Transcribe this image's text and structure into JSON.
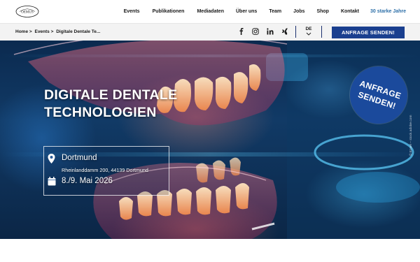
{
  "header": {
    "nav": [
      {
        "label": "Events",
        "name": "nav-events"
      },
      {
        "label": "Publikationen",
        "name": "nav-publikationen"
      },
      {
        "label": "Mediadaten",
        "name": "nav-mediadaten"
      },
      {
        "label": "Über uns",
        "name": "nav-ueber-uns"
      },
      {
        "label": "Team",
        "name": "nav-team"
      },
      {
        "label": "Jobs",
        "name": "nav-jobs"
      },
      {
        "label": "Shop",
        "name": "nav-shop"
      },
      {
        "label": "Kontakt",
        "name": "nav-kontakt"
      }
    ],
    "jubilee": "30 starke Jahre"
  },
  "breadcrumb": {
    "items": [
      "Home >",
      "Events >",
      "Digitale Dentale Te..."
    ]
  },
  "social": {
    "icons": [
      "facebook-icon",
      "instagram-icon",
      "linkedin-icon",
      "xing-icon"
    ]
  },
  "language": {
    "current": "DE"
  },
  "cta": {
    "label": "ANFRAGE SENDEN!"
  },
  "hero": {
    "title_line1": "DIGITALE DENTALE",
    "title_line2": "TECHNOLOGIEN",
    "city": "Dortmund",
    "address": "Rheinlanddamm 200, 44139 Dortmund",
    "date": "8./9. Mai 2026",
    "badge_line1": "ANFRAGE",
    "badge_line2": "SENDEN!",
    "credit": "© Ezael – stock.adobe.com"
  },
  "colors": {
    "brand_blue": "#1a3f8f",
    "jubilee_blue": "#2d6fa8",
    "badge_blue": "#1b4a9c"
  }
}
